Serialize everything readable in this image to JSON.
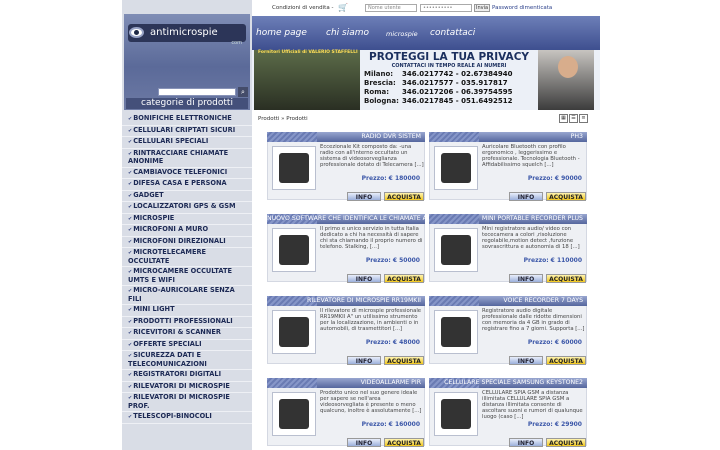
{
  "topbar": {
    "conditions": "Condizioni di vendita -",
    "username_placeholder": "Nome utente",
    "password_value": "••••••••••",
    "send_label": "Invia",
    "forgot_label": "Password dimenticata"
  },
  "logo": {
    "brand": "antimicrospie",
    "brand_suffix": "com",
    "categories_label": "categorie di prodotti"
  },
  "nav": {
    "items": [
      "home page",
      "chi siamo",
      "microspie",
      "contattaci"
    ]
  },
  "banner": {
    "photo_caption": "Fornitori Ufficiali di VALERIO STAFFELLI",
    "title": "PROTEGGI LA TUA PRIVACY",
    "subtitle": "CONTATTACI IN TEMPO REALE AI NUMERI",
    "phones": [
      {
        "city": "Milano:",
        "numbers": "346.0217742 - 02.67384940"
      },
      {
        "city": "Brescia:",
        "numbers": "346.0217577 - 035.917817"
      },
      {
        "city": "Roma:",
        "numbers": "346.0217206 - 06.39754595"
      },
      {
        "city": "Bologna:",
        "numbers": "346.0217845 - 051.6492512"
      }
    ]
  },
  "breadcrumb": "Prodotti » Prodotti",
  "categories": [
    "BONIFICHE ELETTRONICHE",
    "CELLULARI CRIPTATI SICURI",
    "CELLULARI SPECIALI",
    "RINTRACCIARE CHIAMATE ANONIME",
    "CAMBIAVOCE TELEFONICI",
    "DIFESA CASA E PERSONA",
    "GADGET",
    "LOCALIZZATORI GPS & GSM",
    "MICROSPIE",
    "MICROFONI A MURO",
    "MICROFONI DIREZIONALI",
    "MICROTELECAMERE OCCULTATE",
    "MICROCAMERE OCCULTATE UMTS E WIFI",
    "MICRO-AURICOLARE SENZA FILI",
    "MINI LIGHT",
    "PRODOTTI PROFESSIONALI",
    "RICEVITORI & SCANNER",
    "OFFERTE SPECIALI",
    "SICUREZZA DATI E TELECOMUNICAZIONI",
    "REGISTRATORI DIGITALI",
    "RILEVATORI DI MICROSPIE",
    "RILEVATORI DI MICROSPIE PROF.",
    "TELESCOPI-BINOCOLI"
  ],
  "buttons": {
    "info": "INFO",
    "buy": "ACQUISTA"
  },
  "products": [
    {
      "title": "RADIO DVR SISTEM",
      "desc": "Eccezionale Kit composto da: -una radio con all'interno occultato un sistema di videosorveglianza professionale dotato di Telecamera [...]",
      "price": "Prezzo: € 180000"
    },
    {
      "title": "PH3",
      "desc": "Auricolare Bluetooth con profilo ergonomico , leggerissimo e professionale. Tecnologia Bluetooth -Affidabilissimo squelch [...]",
      "price": "Prezzo: € 90000"
    },
    {
      "title": "NUOVO SOFTWARE CHE IDENTIFICA LE CHIAMATE ANONIME",
      "desc": "Il primo e unico servizio in tutta Italia dedicato a chi ha necessità di sapere chi sta chiamando il proprio numero di telefono. Stalking, [...]",
      "price": "Prezzo: € 50000"
    },
    {
      "title": "MINI PORTABLE RECORDER PLUS",
      "desc": "Mini registratore audio/ video con tececamera a colori ,risoluzione regolabile,motion detect ,funzione sovrascrittura e autonomia di 18 [...]",
      "price": "Prezzo: € 110000"
    },
    {
      "title": "RILEVATORE DI MICROSPIE RR19MKII",
      "desc": "Il rilevatore di microspie professionale RR19MKII A\" un utilissimo strumento per la localizzazione, in ambienti o in automobili, di trasmettitori [...]",
      "price": "Prezzo: € 48000"
    },
    {
      "title": "VOICE RECORDER 7 DAYS",
      "desc": "Registratore audio digitale professionale dalle ridotte dimensioni con memoria da 4 GB in grado di registrare fino a 7 giorni. Supporta [...]",
      "price": "Prezzo: € 60000"
    },
    {
      "title": "VIDEOALLARME PIR",
      "desc": "Prodotto unico nel suo genere ideale per sapere se nell'area videosorvegliata è presente o meno qualcuno, inoltre è assolutamente [...]",
      "price": "Prezzo: € 160000"
    },
    {
      "title": "CELLULARE SPECIALE SAMSUNG KEYSTONE2",
      "desc": "CELLULARE SPIA GSM a distanza illimitata CELLULARE SPIA GSM a distanza illimitata consente di ascoltare suoni e rumori di qualunque luogo (caso [...]",
      "price": "Prezzo: € 29900"
    }
  ]
}
